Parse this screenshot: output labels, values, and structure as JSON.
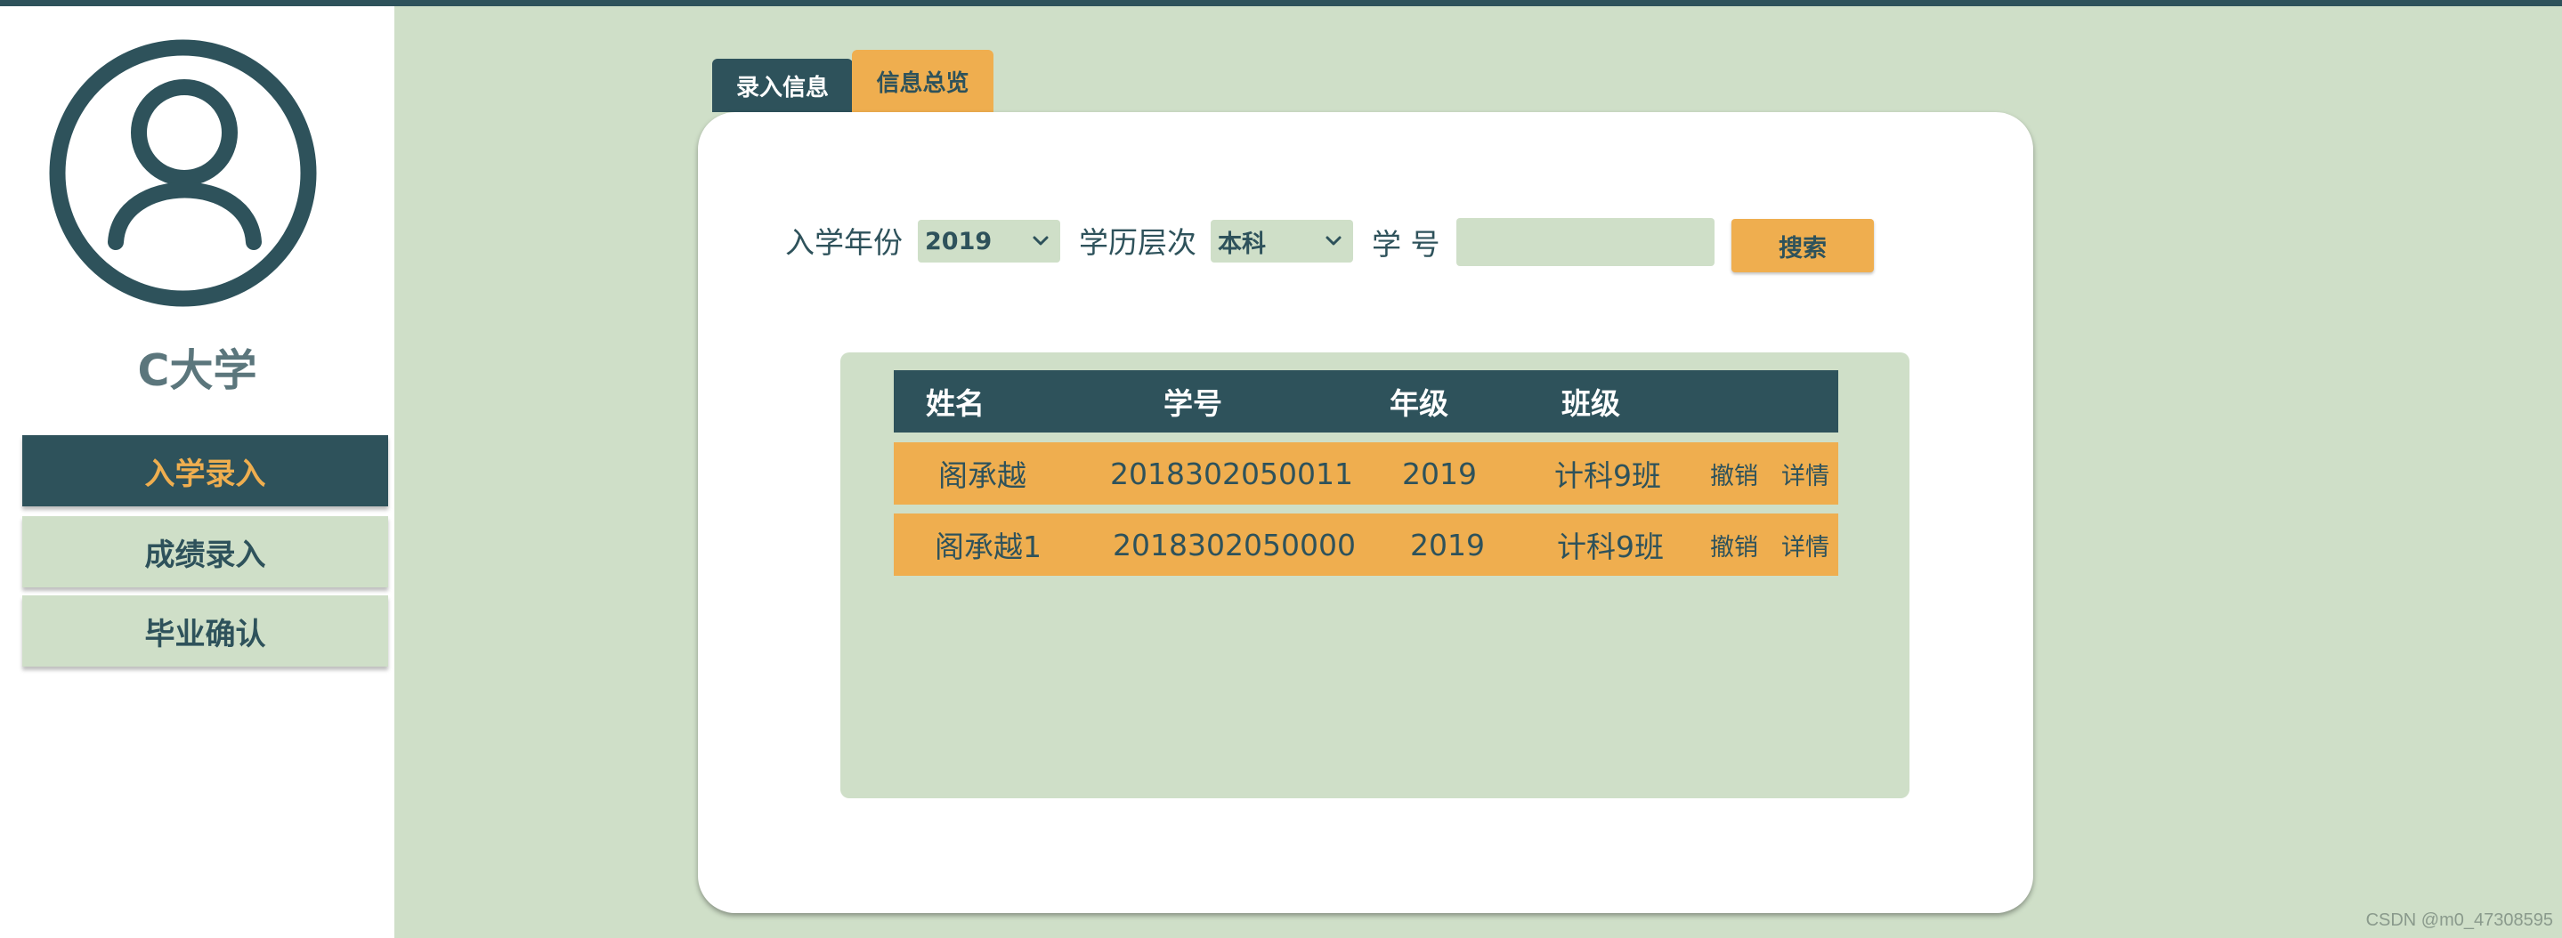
{
  "sidebar": {
    "university_name": "C大学",
    "nav": [
      {
        "label": "入学录入",
        "active": true
      },
      {
        "label": "成绩录入",
        "active": false
      },
      {
        "label": "毕业确认",
        "active": false
      }
    ]
  },
  "tabs": [
    {
      "label": "录入信息"
    },
    {
      "label": "信息总览",
      "active": true
    }
  ],
  "filters": {
    "year_label": "入学年份",
    "year_value": "2019",
    "level_label": "学历层次",
    "level_value": "本科",
    "id_label": "学 号",
    "id_value": "",
    "search_label": "搜索"
  },
  "table": {
    "headers": [
      "姓名",
      "学号",
      "年级",
      "班级"
    ],
    "rows": [
      {
        "name": "阁承越",
        "id": "2018302050011",
        "grade": "2019",
        "class": "计科9班",
        "revoke": "撤销",
        "detail": "详情"
      },
      {
        "name": "阁承越1",
        "id": "2018302050000",
        "grade": "2019",
        "class": "计科9班",
        "revoke": "撤销",
        "detail": "详情"
      }
    ]
  },
  "watermark": "CSDN @m0_47308595",
  "colors": {
    "dark_teal": "#2e525b",
    "orange": "#efae4f",
    "light_green": "#cfdfc8",
    "white": "#ffffff"
  },
  "icons": {
    "avatar": "user-avatar-icon",
    "dropdown": "chevron-down-icon"
  }
}
